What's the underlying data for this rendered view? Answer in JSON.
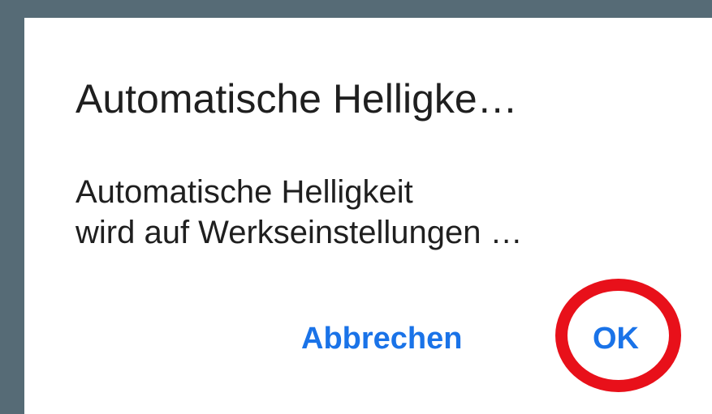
{
  "dialog": {
    "title": "Automatische Helligke…",
    "message_lines": [
      "Automatische Helligkeit",
      "wird auf Werkseinstellungen …"
    ],
    "buttons": {
      "cancel_label": "Abbrechen",
      "ok_label": "OK"
    }
  },
  "colors": {
    "backdrop": "#566b76",
    "dialog_background": "#ffffff",
    "text": "#1f1f1f",
    "button_text": "#1a73e8",
    "highlight": "#e8101a"
  }
}
